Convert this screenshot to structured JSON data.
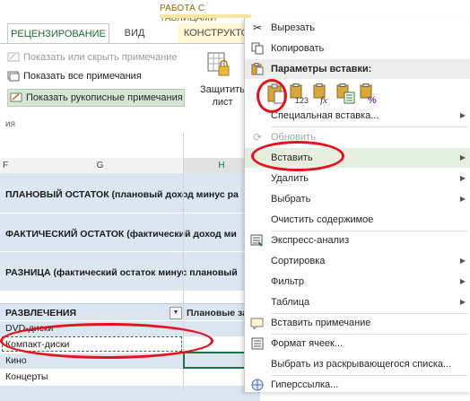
{
  "ribbon": {
    "context_title": "РАБОТА С ТАБЛИЦАМИ",
    "tabs": [
      "РЕЦЕНЗИРОВАНИЕ",
      "ВИД",
      "КОНСТРУКТО"
    ],
    "toggle_comment": "Показать или скрыть примечание",
    "show_all_comments": "Показать все примечания",
    "show_ink": "Показать рукописные примечания",
    "protect_label_1": "Защитить",
    "protect_label_2": "лист",
    "group_label": "ия"
  },
  "sheet": {
    "columns": [
      "F",
      "G",
      "H"
    ],
    "summary_rows": [
      "ПЛАНОВЫЙ ОСТАТОК (плановый доход минус ра",
      "ФАКТИЧЕСКИЙ ОСТАТОК (фактический доход ми",
      "РАЗНИЦА (фактический остаток минус плановый"
    ],
    "table_header": "РАЗВЛЕЧЕНИЯ",
    "table_header_h": "Плановые за",
    "filter_glyph": "▼",
    "rows": [
      "DVD-диски",
      "Компакт-диски",
      "Кино",
      "Концерты",
      ""
    ]
  },
  "menu": {
    "cut": "Вырезать",
    "copy": "Копировать",
    "paste_options": "Параметры вставки:",
    "paste_special": "Специальная вставка...",
    "refresh": "Обновить",
    "insert": "Вставить",
    "delete": "Удалить",
    "select": "Выбрать",
    "clear": "Очистить содержимое",
    "quick_analysis": "Экспресс-анализ",
    "sort": "Сортировка",
    "filter": "Фильтр",
    "table": "Таблица",
    "insert_comment": "Вставить примечание",
    "format_cells": "Формат ячеек...",
    "pick_from_list": "Выбрать из раскрывающегося списка...",
    "hyperlink": "Гиперссылка...",
    "arrow": "▶",
    "paste_icon_123": "123",
    "paste_icon_fx": "fx",
    "paste_icon_pct": "%"
  },
  "colors": {
    "accent_green": "#217346",
    "annotation_red": "#e8101a",
    "table_band": "#dce6f0"
  }
}
